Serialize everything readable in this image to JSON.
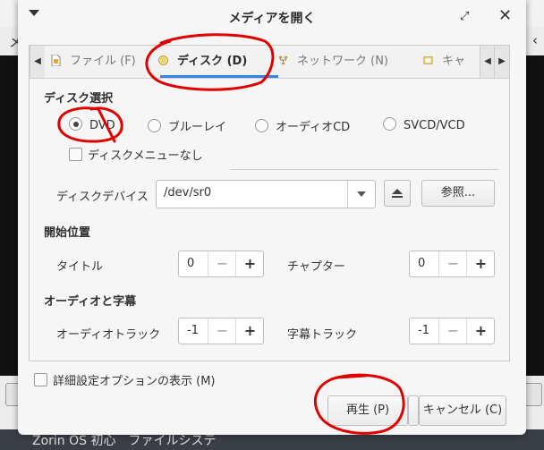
{
  "background": {
    "menu_fragment": "メ",
    "taskbar_text": "Zorin OS 初心　ファイルシステ"
  },
  "dialog": {
    "title": "メディアを開く",
    "tabs": [
      {
        "label": "ファイル (F)",
        "icon": "file-icon",
        "active": false
      },
      {
        "label": "ディスク (D)",
        "icon": "disc-icon",
        "active": true
      },
      {
        "label": "ネットワーク (N)",
        "icon": "network-icon",
        "active": false
      },
      {
        "label": "キャ",
        "icon": "capture-icon",
        "active": false
      }
    ],
    "disc_selection": {
      "heading": "ディスク選択",
      "options": [
        {
          "label": "DVD",
          "checked": true
        },
        {
          "label": "ブルーレイ",
          "checked": false
        },
        {
          "label": "オーディオCD",
          "checked": false
        },
        {
          "label": "SVCD/VCD",
          "checked": false
        }
      ],
      "no_menu_label": "ディスクメニューなし",
      "device_label": "ディスクデバイス",
      "device_value": "/dev/sr0",
      "browse_label": "参照..."
    },
    "start_position": {
      "heading": "開始位置",
      "title_label": "タイトル",
      "title_value": "0",
      "chapter_label": "チャプター",
      "chapter_value": "0"
    },
    "audio_subtitles": {
      "heading": "オーディオと字幕",
      "audio_label": "オーディオトラック",
      "audio_value": "-1",
      "subtitle_label": "字幕トラック",
      "subtitle_value": "-1"
    },
    "advanced_label": "詳細設定オプションの表示 (M)",
    "play_label": "再生 (P)",
    "cancel_label": "キャンセル (C)",
    "accent_color": "#3584e4",
    "annotation_color": "#e00000"
  }
}
